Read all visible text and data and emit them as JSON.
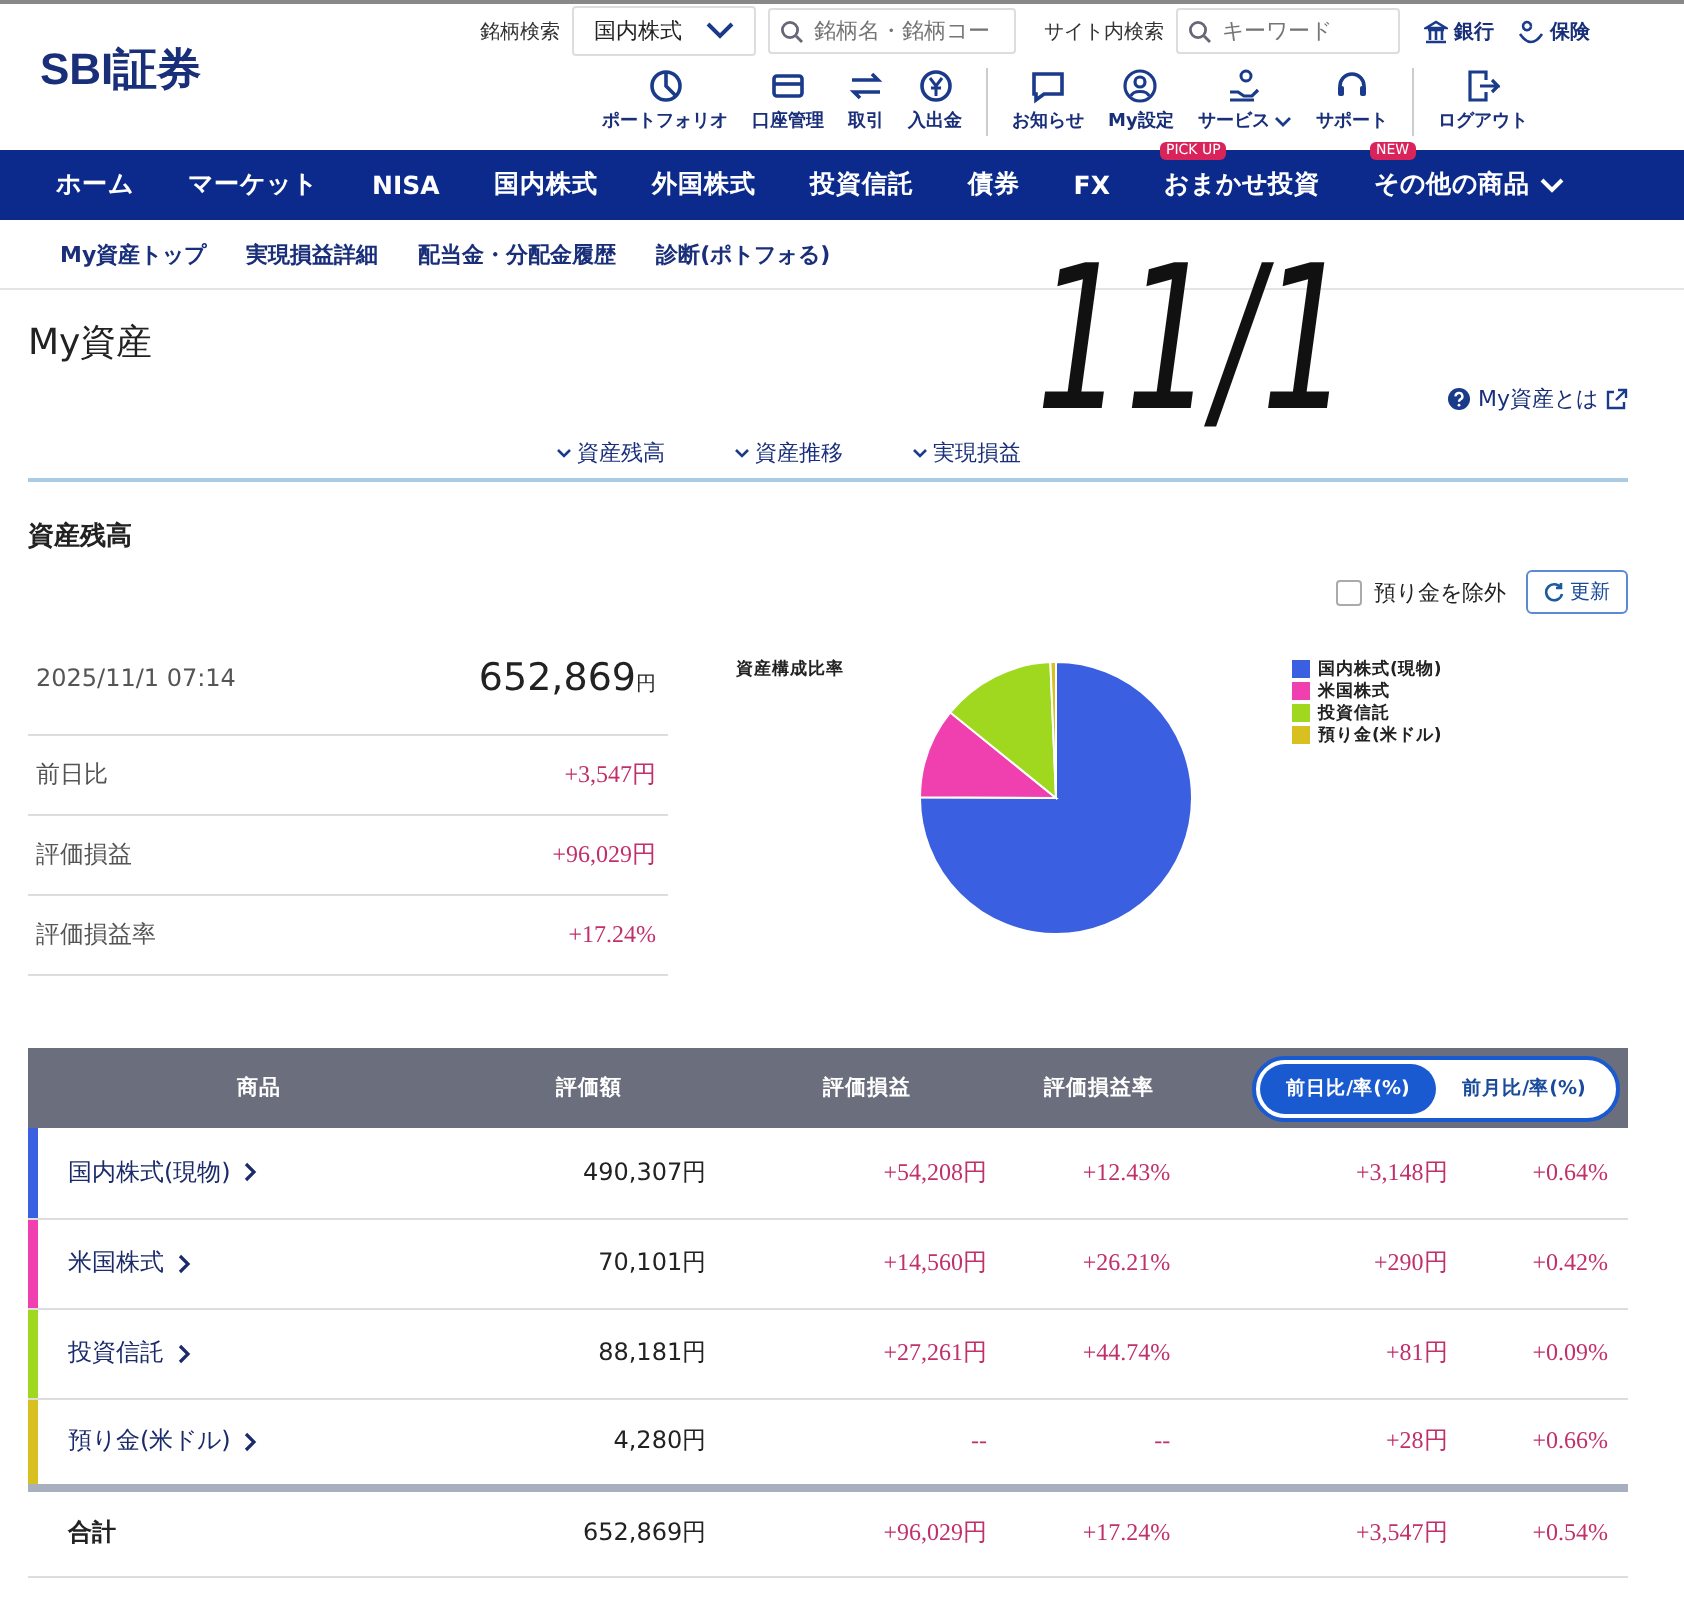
{
  "logo": "SBI証券",
  "header": {
    "stock_search_label": "銘柄検索",
    "market_select": "国内株式",
    "stock_search_placeholder": "銘柄名・銘柄コー",
    "site_search_label": "サイト内検索",
    "site_search_placeholder": "キーワード",
    "links": [
      {
        "label": "銀行",
        "kind": "bank"
      },
      {
        "label": "保険",
        "kind": "insurance"
      }
    ]
  },
  "toolbar_groups": [
    [
      {
        "label": "ポートフォリオ",
        "kind": "portfolio",
        "has_menu": false
      },
      {
        "label": "口座管理",
        "kind": "card",
        "has_menu": false
      },
      {
        "label": "取引",
        "kind": "trade",
        "has_menu": false
      },
      {
        "label": "入出金",
        "kind": "yen",
        "has_menu": false
      }
    ],
    [
      {
        "label": "お知らせ",
        "kind": "message",
        "has_menu": false
      },
      {
        "label": "My設定",
        "kind": "user",
        "has_menu": false
      },
      {
        "label": "サービス",
        "kind": "service",
        "has_menu": true
      },
      {
        "label": "サポート",
        "kind": "support",
        "has_menu": false
      }
    ],
    [
      {
        "label": "ログアウト",
        "kind": "logout",
        "has_menu": false
      }
    ]
  ],
  "main_nav": [
    {
      "label": "ホーム",
      "has_menu": false
    },
    {
      "label": "マーケット",
      "has_menu": false
    },
    {
      "label": "NISA",
      "has_menu": false
    },
    {
      "label": "国内株式",
      "has_menu": false
    },
    {
      "label": "外国株式",
      "has_menu": false
    },
    {
      "label": "投資信託",
      "has_menu": false
    },
    {
      "label": "債券",
      "has_menu": false
    },
    {
      "label": "FX",
      "has_menu": false
    },
    {
      "label": "おまかせ投資",
      "badge": "PICK UP",
      "has_menu": false
    },
    {
      "label": "その他の商品",
      "badge": "NEW",
      "has_menu": true
    }
  ],
  "sub_nav": [
    "My資産トップ",
    "実現損益詳細",
    "配当金・分配金履歴",
    "診断(ポトフォる)"
  ],
  "annotation": "11/1",
  "page": {
    "title": "My資産",
    "help_link": "My資産とは",
    "anchors": [
      "資産残高",
      "資産推移",
      "実現損益"
    ]
  },
  "balance": {
    "heading": "資産残高",
    "exclude_deposit": {
      "label": "預り金を除外",
      "checked": false
    },
    "refresh": "更新",
    "timestamp": "2025/11/1 07:14",
    "total": "652,869",
    "unit": "円",
    "stats": [
      {
        "label": "前日比",
        "value": "+3,547円"
      },
      {
        "label": "評価損益",
        "value": "+96,029円"
      },
      {
        "label": "評価損益率",
        "value": "+17.24%"
      }
    ],
    "chart_data": {
      "type": "pie",
      "title": "資産構成比率",
      "categories": [
        "国内株式(現物)",
        "米国株式",
        "投資信託",
        "預り金(米ドル)"
      ],
      "values": [
        75.09,
        10.74,
        13.51,
        0.66
      ],
      "legend": "right",
      "colors": [
        "#3a5fe0",
        "#f040b0",
        "#a0d820",
        "#d8c020"
      ]
    }
  },
  "table": {
    "columns": [
      "商品",
      "評価額",
      "評価損益",
      "評価損益率"
    ],
    "toggle": [
      {
        "label": "前日比/率(%)",
        "selected": true
      },
      {
        "label": "前月比/率(%)",
        "selected": false
      }
    ],
    "rows": [
      {
        "name": "国内株式(現物)",
        "color": "#3a5fe0",
        "value": "490,307円",
        "pl": "+54,208円",
        "pl_rate": "+12.43%",
        "change": "+3,148円",
        "change_rate": "+0.64%"
      },
      {
        "name": "米国株式",
        "color": "#f040b0",
        "value": "70,101円",
        "pl": "+14,560円",
        "pl_rate": "+26.21%",
        "change": "+290円",
        "change_rate": "+0.42%"
      },
      {
        "name": "投資信託",
        "color": "#a0d820",
        "value": "88,181円",
        "pl": "+27,261円",
        "pl_rate": "+44.74%",
        "change": "+81円",
        "change_rate": "+0.09%"
      },
      {
        "name": "預り金(米ドル)",
        "color": "#d8c020",
        "value": "4,280円",
        "pl": "--",
        "pl_rate": "--",
        "change": "+28円",
        "change_rate": "+0.66%"
      }
    ],
    "total": {
      "name": "合計",
      "value": "652,869円",
      "pl": "+96,029円",
      "pl_rate": "+17.24%",
      "change": "+3,547円",
      "change_rate": "+0.54%"
    }
  }
}
